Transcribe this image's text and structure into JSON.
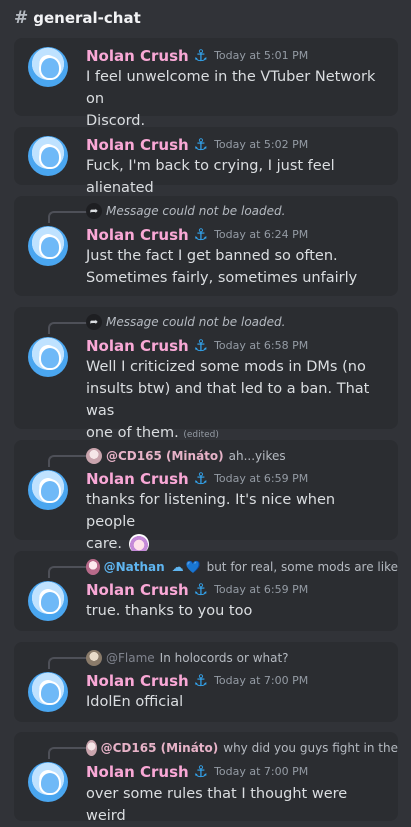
{
  "channel": {
    "hash": "#",
    "name": "general-chat"
  },
  "user": {
    "name": "Nolan Crush",
    "badge": "⚓"
  },
  "messages": [
    {
      "time": "Today at 5:01 PM",
      "lines": [
        "I feel unwelcome in the VTuber Network on",
        "Discord."
      ]
    },
    {
      "time": "Today at 5:02 PM",
      "lines": [
        "Fuck, I'm back to crying, I just feel alienated"
      ]
    },
    {
      "reply": {
        "type": "missing",
        "text": "Message could not be loaded."
      },
      "time": "Today at 6:24 PM",
      "lines": [
        "Just the fact I get banned so often.",
        "Sometimes fairly, sometimes unfairly"
      ]
    },
    {
      "reply": {
        "type": "missing",
        "text": "Message could not be loaded."
      },
      "time": "Today at 6:58 PM",
      "lines": [
        "Well I criticized some mods in DMs (no",
        "insults btw) and that led to a ban. That was",
        "one of them."
      ],
      "edited": "(edited)"
    },
    {
      "reply": {
        "type": "user",
        "author": "@CD165 (Mináto)",
        "text": "ah...yikes"
      },
      "time": "Today at 6:59 PM",
      "lines": [
        "thanks for listening. It's nice when people",
        "care."
      ]
    },
    {
      "reply": {
        "type": "user",
        "author": "@Nathan",
        "cloud": "☁",
        "heart": "💙",
        "text": "but for real, some mods are like"
      },
      "time": "Today at 6:59 PM",
      "lines": [
        "true. thanks to you too"
      ]
    },
    {
      "reply": {
        "type": "user",
        "author": "@Flame",
        "text": "In holocords or what?"
      },
      "time": "Today at 7:00 PM",
      "lines": [
        "IdolEn official"
      ]
    },
    {
      "reply": {
        "type": "user",
        "author": "@CD165 (Mináto)",
        "text": "why did you guys fight in the"
      },
      "time": "Today at 7:00 PM",
      "lines": [
        "over some rules that I thought were weird"
      ]
    }
  ]
}
